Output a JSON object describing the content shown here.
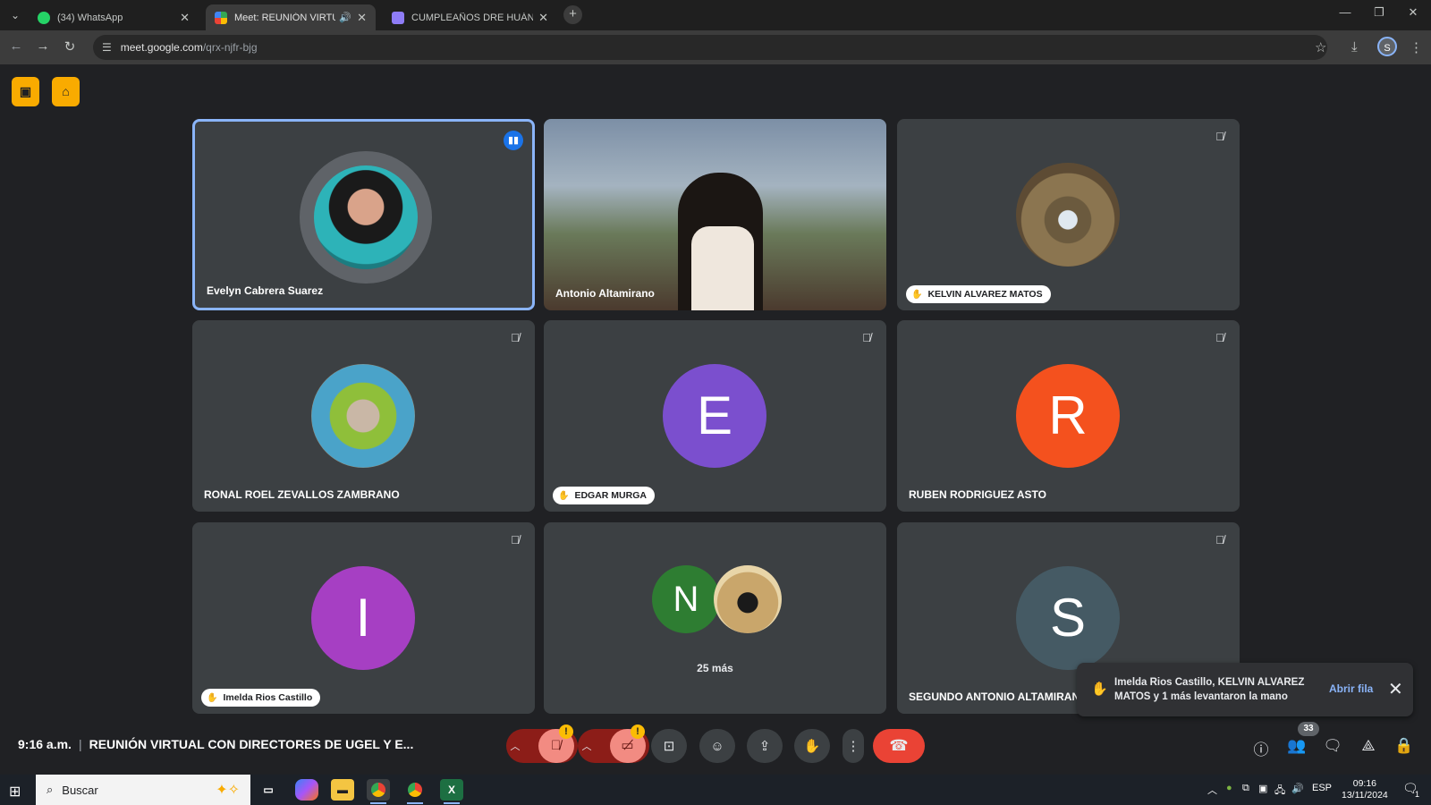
{
  "browser": {
    "tabs": [
      {
        "title": "(34) WhatsApp",
        "active": false
      },
      {
        "title": "Meet: REUNIÓN VIRTUAL C",
        "active": true
      },
      {
        "title": "CUMPLEAÑOS DRE HUÁNUCO",
        "active": false
      }
    ],
    "url_host": "meet.google.com",
    "url_path": "/qrx-njfr-bjg",
    "profile_initial": "S"
  },
  "tiles": [
    {
      "name": "Evelyn Cabrera Suarez",
      "speaking": true
    },
    {
      "name": "Antonio Altamirano"
    },
    {
      "name": "KELVIN ALVAREZ MATOS",
      "hand_raised": true
    },
    {
      "name": "RONAL ROEL ZEVALLOS ZAMBRANO"
    },
    {
      "name": "EDGAR MURGA",
      "hand_raised": true,
      "avatar_letter": "E",
      "avatar_color": "#7b4fce"
    },
    {
      "name": "RUBEN RODRIGUEZ ASTO",
      "avatar_letter": "R",
      "avatar_color": "#f4511e"
    },
    {
      "name": "Imelda Rios Castillo",
      "hand_raised": true,
      "avatar_letter": "I",
      "avatar_color": "#a63fc3"
    },
    {
      "more_label": "25 más",
      "avatar_letter": "N",
      "avatar_color": "#2e7d32"
    },
    {
      "name": "SEGUNDO ANTONIO ALTAMIRANO",
      "avatar_letter": "S",
      "avatar_color": "#455a64"
    }
  ],
  "notification": {
    "message": "Imelda Rios Castillo, KELVIN ALVAREZ MATOS y 1 más levantaron la mano",
    "action": "Abrir fila"
  },
  "meeting": {
    "time": "9:16 a.m.",
    "title": "REUNIÓN VIRTUAL CON DIRECTORES DE UGEL Y E...",
    "participants_count": "33"
  },
  "taskbar": {
    "search_placeholder": "Buscar",
    "language": "ESP",
    "time": "09:16",
    "date": "13/11/2024",
    "notifications": "1"
  },
  "colors": {
    "accent_blue": "#8ab4f8",
    "end_call": "#ea4335",
    "warning": "#fbbc04"
  }
}
